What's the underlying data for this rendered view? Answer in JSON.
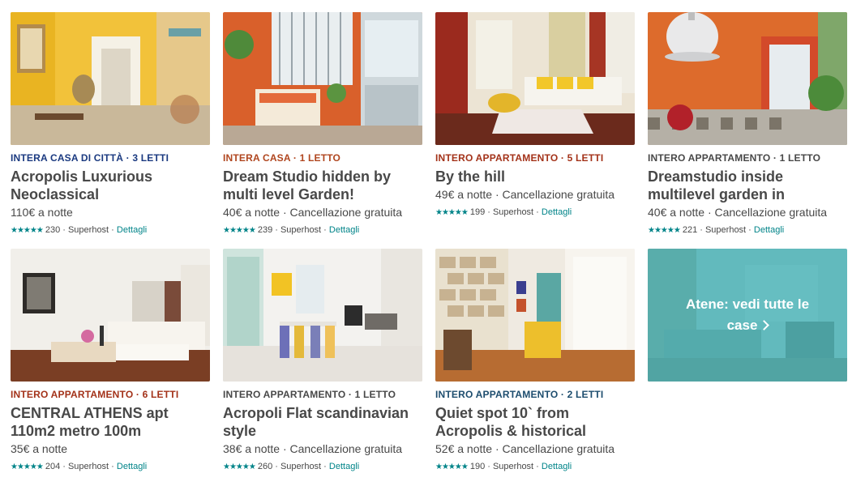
{
  "listings": [
    {
      "kicker": "INTERA CASA DI CITTÀ · 3 LETTI",
      "kicker_color": "#1b3a80",
      "title": "Acropolis Luxurious Neoclassical",
      "price": "110€ a notte",
      "stars": "★★★★★",
      "reviews": "230",
      "superhost": "· Superhost ·",
      "details": "Dettagli"
    },
    {
      "kicker": "INTERA CASA · 1 LETTO",
      "kicker_color": "#b0461f",
      "title": "Dream Studio hidden by multi level Garden!",
      "price": "40€ a notte · Cancellazione gratuita",
      "stars": "★★★★★",
      "reviews": "239",
      "superhost": "· Superhost ·",
      "details": "Dettagli"
    },
    {
      "kicker": "INTERO APPARTAMENTO · 5 LETTI",
      "kicker_color": "#a33219",
      "title": "By the hill",
      "price": "49€ a notte · Cancellazione gratuita",
      "stars": "★★★★★",
      "reviews": "199",
      "superhost": "· Superhost ·",
      "details": "Dettagli"
    },
    {
      "kicker": "INTERO APPARTAMENTO · 1 LETTO",
      "kicker_color": "#484848",
      "title": "Dreamstudio inside multilevel garden in",
      "price": "40€ a notte · Cancellazione gratuita",
      "stars": "★★★★★",
      "reviews": "221",
      "superhost": "· Superhost ·",
      "details": "Dettagli"
    },
    {
      "kicker": "INTERO APPARTAMENTO · 6 LETTI",
      "kicker_color": "#a33219",
      "title": "CENTRAL ATHENS apt 110m2 metro 100m",
      "price": "35€ a notte",
      "stars": "★★★★★",
      "reviews": "204",
      "superhost": "· Superhost ·",
      "details": "Dettagli"
    },
    {
      "kicker": "INTERO APPARTAMENTO · 1 LETTO",
      "kicker_color": "#484848",
      "title": "Acropoli Flat scandinavian style",
      "price": "38€ a notte · Cancellazione gratuita",
      "stars": "★★★★★",
      "reviews": "260",
      "superhost": "· Superhost ·",
      "details": "Dettagli"
    },
    {
      "kicker": "INTERO APPARTAMENTO · 2 LETTI",
      "kicker_color": "#1d4d6e",
      "title": "Quiet spot 10` from Acropolis & historical",
      "price": "52€ a notte · Cancellazione gratuita",
      "stars": "★★★★★",
      "reviews": "190",
      "superhost": "· Superhost ·",
      "details": "Dettagli"
    }
  ],
  "see_all": {
    "label": "Atene: vedi tutte le case"
  },
  "colors": {
    "accent_teal": "#008489",
    "overlay_teal": "#48b4ba"
  }
}
